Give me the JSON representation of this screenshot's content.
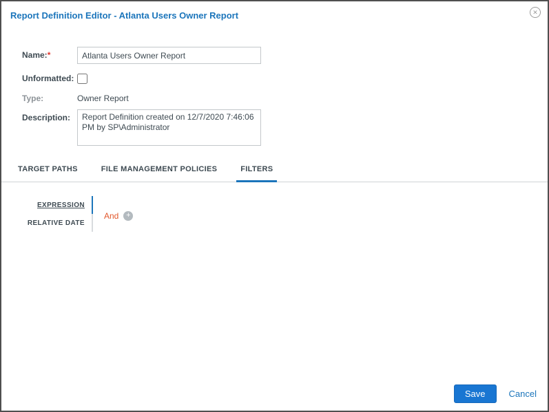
{
  "dialog": {
    "title": "Report Definition Editor - Atlanta Users Owner Report",
    "close_glyph": "✕"
  },
  "form": {
    "name_label": "Name:",
    "name_required_mark": "*",
    "name_value": "Atlanta Users Owner Report",
    "unformatted_label": "Unformatted:",
    "type_label": "Type:",
    "type_value": "Owner Report",
    "description_label": "Description:",
    "description_value": "Report Definition created on 12/7/2020 7:46:06 PM by SP\\Administrator"
  },
  "tabs": [
    {
      "label": "TARGET PATHS",
      "active": false
    },
    {
      "label": "FILE MANAGEMENT POLICIES",
      "active": false
    },
    {
      "label": "FILTERS",
      "active": true
    }
  ],
  "filters": {
    "subtabs": [
      {
        "label": "EXPRESSION",
        "active": true
      },
      {
        "label": "RELATIVE DATE",
        "active": false
      }
    ],
    "expression": {
      "operator": "And",
      "add_glyph": "+"
    }
  },
  "footer": {
    "save_label": "Save",
    "cancel_label": "Cancel"
  },
  "colors": {
    "accent_blue": "#1b75bb",
    "operator_orange": "#e2572b",
    "label_dark": "#3e4a52",
    "border_dark": "#4f4f4f"
  }
}
